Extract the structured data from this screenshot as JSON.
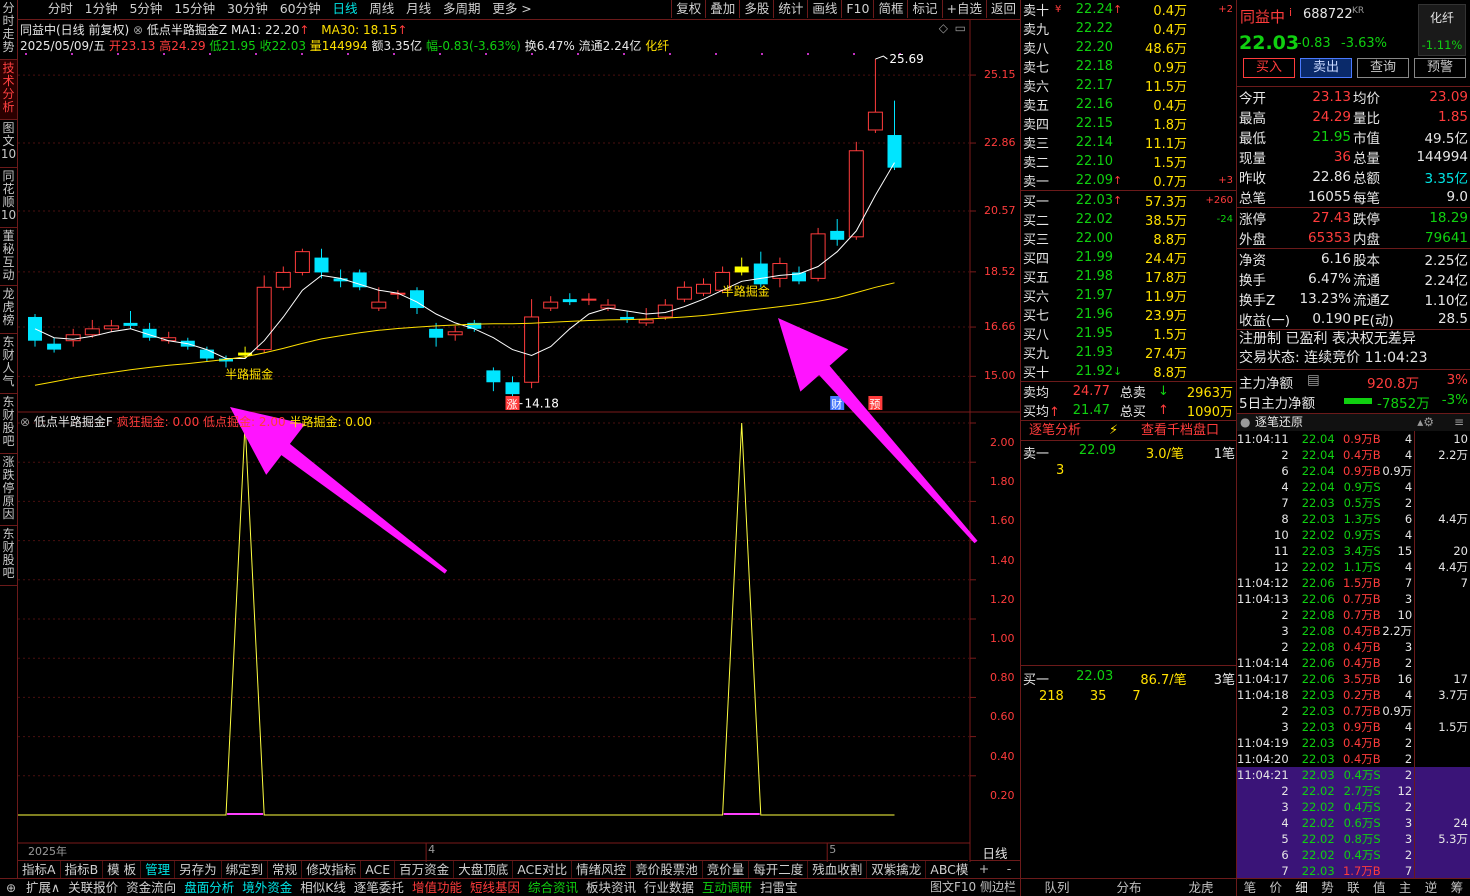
{
  "left_tabs": [
    "分时走势",
    "技术分析",
    "图文10",
    "同花顺10",
    "董秘互动",
    "龙虎榜",
    "东财人气",
    "东财股吧",
    "涨跌停原因",
    "东财股吧"
  ],
  "period_tabs": [
    "分时",
    "1分钟",
    "5分钟",
    "15分钟",
    "30分钟",
    "60分钟",
    "日线",
    "周线",
    "月线",
    "多周期",
    "更多 >"
  ],
  "right_tools": [
    "复权",
    "叠加",
    "多股",
    "统计",
    "画线",
    "F10",
    "简框",
    "标记",
    "+自选",
    "返回"
  ],
  "chart_header": {
    "title": "同益中(日线 前复权)",
    "indicator": "低点半路掘金Z",
    "ma1": "MA1: 22.20",
    "ma30": "MA30: 18.15"
  },
  "info_line": {
    "date": "2025/05/09/五",
    "open": "开23.13",
    "high": "高24.29",
    "low": "低21.95",
    "close": "收22.03",
    "vol": "量144994",
    "amount": "额3.35亿",
    "change": "幅-0.83(-3.63%)",
    "turn": "换6.47%",
    "float": "流通2.24亿",
    "sector": "化纤"
  },
  "price_axis": [
    "25.15",
    "22.86",
    "20.57",
    "18.52",
    "16.66",
    "15.00"
  ],
  "sub_axis": [
    "2.00",
    "1.80",
    "1.60",
    "1.40",
    "1.20",
    "1.00",
    "0.80",
    "0.60",
    "0.40",
    "0.20"
  ],
  "chart_data": {
    "type": "candlestick",
    "x": [
      "2025-03-03",
      "2025-03-04",
      "2025-03-05",
      "2025-03-06",
      "2025-03-07",
      "2025-03-10",
      "2025-03-11",
      "2025-03-12",
      "2025-03-13",
      "2025-03-14",
      "2025-03-17",
      "2025-03-18",
      "2025-03-19",
      "2025-03-20",
      "2025-03-21",
      "2025-03-24",
      "2025-03-25",
      "2025-03-26",
      "2025-03-27",
      "2025-03-28",
      "2025-03-31",
      "2025-04-01",
      "2025-04-02",
      "2025-04-03",
      "2025-04-07",
      "2025-04-08",
      "2025-04-09",
      "2025-04-10",
      "2025-04-11",
      "2025-04-14",
      "2025-04-15",
      "2025-04-16",
      "2025-04-17",
      "2025-04-18",
      "2025-04-21",
      "2025-04-22",
      "2025-04-23",
      "2025-04-24",
      "2025-04-25",
      "2025-04-28",
      "2025-04-29",
      "2025-04-30",
      "2025-05-06",
      "2025-05-07",
      "2025-05-08",
      "2025-05-09"
    ],
    "candles": [
      [
        17.0,
        16.2,
        17.1,
        16.0
      ],
      [
        16.1,
        15.9,
        16.3,
        15.8
      ],
      [
        16.2,
        16.4,
        16.6,
        16.0
      ],
      [
        16.4,
        16.6,
        16.9,
        16.3
      ],
      [
        16.6,
        16.7,
        16.9,
        16.5
      ],
      [
        16.8,
        16.7,
        17.2,
        16.6
      ],
      [
        16.6,
        16.3,
        16.8,
        16.2
      ],
      [
        16.2,
        16.3,
        16.5,
        16.1
      ],
      [
        16.2,
        16.0,
        16.3,
        15.9
      ],
      [
        15.9,
        15.6,
        16.0,
        15.5
      ],
      [
        15.6,
        15.5,
        15.7,
        15.3
      ],
      [
        15.7,
        15.8,
        16.0,
        15.6
      ],
      [
        15.9,
        18.0,
        18.4,
        15.8
      ],
      [
        18.0,
        18.5,
        18.7,
        17.9
      ],
      [
        18.5,
        19.2,
        19.3,
        18.4
      ],
      [
        19.0,
        18.5,
        19.3,
        18.3
      ],
      [
        18.3,
        18.2,
        18.6,
        18.0
      ],
      [
        18.5,
        18.0,
        18.6,
        17.9
      ],
      [
        17.3,
        17.5,
        18.0,
        17.2
      ],
      [
        17.8,
        17.8,
        17.9,
        17.6
      ],
      [
        17.9,
        17.3,
        18.0,
        17.1
      ],
      [
        16.6,
        16.3,
        16.8,
        16.0
      ],
      [
        16.4,
        16.5,
        16.7,
        16.2
      ],
      [
        16.8,
        16.6,
        16.9,
        16.5
      ],
      [
        15.2,
        14.8,
        15.3,
        14.5
      ],
      [
        14.8,
        14.4,
        15.0,
        14.18
      ],
      [
        14.8,
        17.0,
        17.6,
        14.6
      ],
      [
        17.3,
        17.5,
        17.7,
        17.2
      ],
      [
        17.6,
        17.5,
        17.8,
        17.4
      ],
      [
        17.6,
        17.6,
        17.8,
        17.4
      ],
      [
        17.3,
        17.4,
        17.6,
        17.2
      ],
      [
        17.0,
        16.9,
        17.2,
        16.8
      ],
      [
        16.8,
        16.9,
        17.3,
        16.7
      ],
      [
        17.0,
        17.4,
        17.6,
        16.9
      ],
      [
        17.6,
        18.0,
        18.2,
        17.5
      ],
      [
        17.8,
        18.1,
        18.3,
        17.7
      ],
      [
        17.9,
        18.5,
        18.7,
        17.8
      ],
      [
        18.5,
        18.7,
        19.0,
        18.4
      ],
      [
        18.8,
        18.1,
        19.2,
        18.0
      ],
      [
        18.3,
        18.8,
        19.0,
        18.0
      ],
      [
        18.5,
        18.2,
        18.7,
        18.1
      ],
      [
        18.3,
        19.8,
        20.0,
        18.2
      ],
      [
        19.9,
        19.6,
        20.3,
        19.4
      ],
      [
        19.7,
        22.6,
        22.9,
        19.6
      ],
      [
        23.3,
        23.9,
        25.69,
        23.2
      ],
      [
        23.13,
        22.03,
        24.29,
        21.95
      ]
    ],
    "ma1": [
      16.6,
      16.3,
      16.25,
      16.35,
      16.5,
      16.6,
      16.4,
      16.2,
      16.1,
      15.9,
      15.6,
      15.6,
      16.2,
      17.0,
      17.9,
      18.4,
      18.3,
      18.1,
      17.9,
      17.8,
      17.5,
      17.1,
      16.8,
      16.6,
      16.3,
      15.9,
      15.7,
      16.0,
      16.6,
      17.1,
      17.3,
      17.2,
      17.1,
      17.15,
      17.35,
      17.6,
      17.9,
      18.2,
      18.3,
      18.4,
      18.45,
      18.7,
      19.2,
      19.9,
      21.1,
      22.2
    ],
    "ma30": [
      14.7,
      14.82,
      14.94,
      15.04,
      15.13,
      15.22,
      15.3,
      15.37,
      15.43,
      15.5,
      15.57,
      15.66,
      15.79,
      15.94,
      16.11,
      16.26,
      16.37,
      16.47,
      16.55,
      16.61,
      16.66,
      16.7,
      16.73,
      16.76,
      16.77,
      16.77,
      16.79,
      16.82,
      16.85,
      16.88,
      16.9,
      16.91,
      16.93,
      16.96,
      17.0,
      17.05,
      17.12,
      17.2,
      17.27,
      17.35,
      17.43,
      17.53,
      17.65,
      17.82,
      18.0,
      18.15
    ],
    "signal": [
      0,
      0,
      0,
      0,
      0,
      0,
      0,
      0,
      0,
      0,
      0,
      2,
      0,
      0,
      0,
      0,
      0,
      0,
      0,
      0,
      0,
      0,
      0,
      0,
      0,
      0,
      0,
      0,
      0,
      0,
      0,
      0,
      0,
      0,
      0,
      0,
      0,
      2,
      0,
      0,
      0,
      0,
      0,
      0,
      0,
      0
    ],
    "marks": {
      "high": "25.69",
      "low": "14.18"
    },
    "annotations": [
      "半路掘金",
      "半路掘金"
    ],
    "ylim": [
      14.0,
      26.5
    ],
    "signal_ylim": [
      0,
      2.0
    ],
    "month_labels": [
      "2025年",
      "4",
      "5"
    ],
    "badges": [
      "涨",
      "财",
      "预"
    ]
  },
  "sub_header": {
    "name": "低点半路掘金F",
    "a": "疯狂掘金: 0.00",
    "b": "低点掘金: 2.00",
    "c": "半路掘金: 0.00"
  },
  "bottom_tabs1": [
    "指标A",
    "指标B",
    "模 板",
    "管理",
    "另存为",
    "绑定到",
    "常规",
    "修改指标",
    "ACE",
    "百万资金",
    "大盘顶底",
    "ACE对比",
    "情绪风控",
    "竞价股票池",
    "竞价量",
    "每开二度",
    "残血收割",
    "双紫擒龙",
    "ABC模型",
    ">"
  ],
  "bottom_tabs2": [
    "扩展∧",
    "关联报价",
    "资金流向",
    "盘面分析",
    "境外资金",
    "相似K线",
    "逐笔委托",
    "增值功能",
    "短线基因",
    "综合资讯",
    "板块资讯",
    "行业数据",
    "互动调研",
    "扫雷宝"
  ],
  "bottom_right": [
    "图文F10",
    "侧边栏",
    "日线",
    "+",
    "-"
  ],
  "stock": {
    "name": "同益中",
    "code": "688722",
    "flag": "KR",
    "price": "22.03",
    "chg": "-0.83",
    "pct": "-3.63%",
    "sector": "化纤",
    "sector_pct": "-1.11%",
    "buttons": [
      "买入",
      "卖出",
      "查询",
      "预警"
    ]
  },
  "sells": [
    [
      "卖十",
      "¥",
      "22.24",
      "↑",
      "0.4万",
      "+2"
    ],
    [
      "卖九",
      "",
      "22.22",
      "",
      "0.4万",
      ""
    ],
    [
      "卖八",
      "",
      "22.20",
      "",
      "48.6万",
      ""
    ],
    [
      "卖七",
      "",
      "22.18",
      "",
      "0.9万",
      ""
    ],
    [
      "卖六",
      "",
      "22.17",
      "",
      "11.5万",
      ""
    ],
    [
      "卖五",
      "",
      "22.16",
      "",
      "0.4万",
      ""
    ],
    [
      "卖四",
      "",
      "22.15",
      "",
      "1.8万",
      ""
    ],
    [
      "卖三",
      "",
      "22.14",
      "",
      "11.1万",
      ""
    ],
    [
      "卖二",
      "",
      "22.10",
      "",
      "1.5万",
      ""
    ],
    [
      "卖一",
      "",
      "22.09",
      "↑",
      "0.7万",
      "+3"
    ]
  ],
  "buys": [
    [
      "买一",
      "",
      "22.03",
      "↑",
      "57.3万",
      "+260"
    ],
    [
      "买二",
      "",
      "22.02",
      "",
      "38.5万",
      "-24"
    ],
    [
      "买三",
      "",
      "22.00",
      "",
      "8.8万",
      ""
    ],
    [
      "买四",
      "",
      "21.99",
      "",
      "24.4万",
      ""
    ],
    [
      "买五",
      "",
      "21.98",
      "",
      "17.8万",
      ""
    ],
    [
      "买六",
      "",
      "21.97",
      "",
      "11.9万",
      ""
    ],
    [
      "买七",
      "",
      "21.96",
      "",
      "23.9万",
      ""
    ],
    [
      "买八",
      "",
      "21.95",
      "",
      "1.5万",
      ""
    ],
    [
      "买九",
      "",
      "21.93",
      "",
      "27.4万",
      ""
    ],
    [
      "买十",
      "",
      "21.92",
      "↓",
      "8.8万",
      ""
    ]
  ],
  "avg": {
    "sell_label": "卖均",
    "sell": "24.77",
    "sell_total_label": "总卖",
    "sell_total": "2963万",
    "buy_label": "买均",
    "buy": "21.47",
    "buy_total_label": "总买",
    "buy_total": "1090万"
  },
  "order_analysis": {
    "title": "逐笔分析",
    "link": "查看千档盘口",
    "s1": "卖一",
    "s1p": "22.09",
    "s1v": "3.0/笔",
    "s1n": "1笔",
    "s1q": "3",
    "b1": "买一",
    "b1p": "22.03",
    "b1v": "86.7/笔",
    "b1n": "3笔",
    "b1q": [
      "218",
      "35",
      "7"
    ]
  },
  "quote": [
    [
      "今开",
      "23.13",
      "均价",
      "23.09"
    ],
    [
      "最高",
      "24.29",
      "量比",
      "1.85"
    ],
    [
      "最低",
      "21.95",
      "市值",
      "49.5亿"
    ],
    [
      "现量",
      "36",
      "总量",
      "144994"
    ],
    [
      "昨收",
      "22.86",
      "总额",
      "3.35亿"
    ],
    [
      "总笔",
      "16055",
      "每笔",
      "9.0"
    ],
    [
      "涨停",
      "27.43",
      "跌停",
      "18.29"
    ],
    [
      "外盘",
      "65353",
      "内盘",
      "79641"
    ],
    [
      "净资",
      "6.16",
      "股本",
      "2.25亿"
    ],
    [
      "换手",
      "6.47%",
      "流通",
      "2.24亿"
    ],
    [
      "换手Z",
      "13.23%",
      "流通Z",
      "1.10亿"
    ],
    [
      "收益(一)",
      "0.190",
      "PE(动)",
      "28.5"
    ]
  ],
  "tags": "注册制 已盈利 表决权无差异",
  "trade_status": "交易状态: 连续竞价 11:04:23",
  "main_flow": {
    "l1": "主力净额",
    "v1": "920.8万",
    "p1": "3%",
    "l2": "5日主力净额",
    "v2": "-7852万",
    "p2": "-3%"
  },
  "ticks_title": "逐笔还原",
  "ticks": [
    [
      "11:04:11",
      "22.04",
      "0.9万B",
      "4",
      "10"
    ],
    [
      "2",
      "22.04",
      "0.4万B",
      "4",
      "2.2万"
    ],
    [
      "6",
      "22.04",
      "0.9万B",
      "0.9万",
      ""
    ],
    [
      "4",
      "22.04",
      "0.9万S",
      "4",
      ""
    ],
    [
      "7",
      "22.03",
      "0.5万S",
      "2",
      ""
    ],
    [
      "8",
      "22.03",
      "1.3万S",
      "6",
      "4.4万"
    ],
    [
      "10",
      "22.02",
      "0.9万S",
      "4",
      ""
    ],
    [
      "11",
      "22.03",
      "3.4万S",
      "15",
      "20"
    ],
    [
      "12",
      "22.02",
      "1.1万S",
      "4",
      "4.4万"
    ],
    [
      "11:04:12",
      "22.06",
      "1.5万B",
      "7",
      "7"
    ],
    [
      "11:04:13",
      "22.06",
      "0.7万B",
      "3",
      ""
    ],
    [
      "2",
      "22.08",
      "0.7万B",
      "10",
      ""
    ],
    [
      "3",
      "22.08",
      "0.4万B",
      "2.2万",
      ""
    ],
    [
      "2",
      "22.08",
      "0.4万B",
      "3",
      ""
    ],
    [
      "11:04:14",
      "22.06",
      "0.4万B",
      "2",
      ""
    ],
    [
      "11:04:17",
      "22.06",
      "3.5万B",
      "16",
      "17"
    ],
    [
      "11:04:18",
      "22.03",
      "0.2万B",
      "4",
      "3.7万"
    ],
    [
      "2",
      "22.03",
      "0.7万B",
      "0.9万",
      ""
    ],
    [
      "3",
      "22.03",
      "0.9万B",
      "4",
      "1.5万"
    ],
    [
      "11:04:19",
      "22.03",
      "0.4万B",
      "2",
      ""
    ],
    [
      "11:04:20",
      "22.03",
      "0.4万B",
      "2",
      ""
    ],
    [
      "11:04:21",
      "22.03",
      "0.4万S",
      "2",
      ""
    ],
    [
      "2",
      "22.02",
      "2.7万S",
      "12",
      ""
    ],
    [
      "3",
      "22.02",
      "0.4万S",
      "2",
      ""
    ],
    [
      "4",
      "22.02",
      "0.6万S",
      "3",
      "24"
    ],
    [
      "5",
      "22.02",
      "0.8万S",
      "3",
      "5.3万"
    ],
    [
      "6",
      "22.02",
      "0.4万S",
      "2",
      ""
    ],
    [
      "7",
      "22.03",
      "1.7万B",
      "7",
      ""
    ]
  ],
  "right_bottom_tabs": [
    "队列",
    "分布",
    "龙虎"
  ],
  "right_bottom_tabs2": [
    "笔",
    "价",
    "细",
    "势",
    "联",
    "值",
    "主",
    "逆",
    "筹"
  ]
}
